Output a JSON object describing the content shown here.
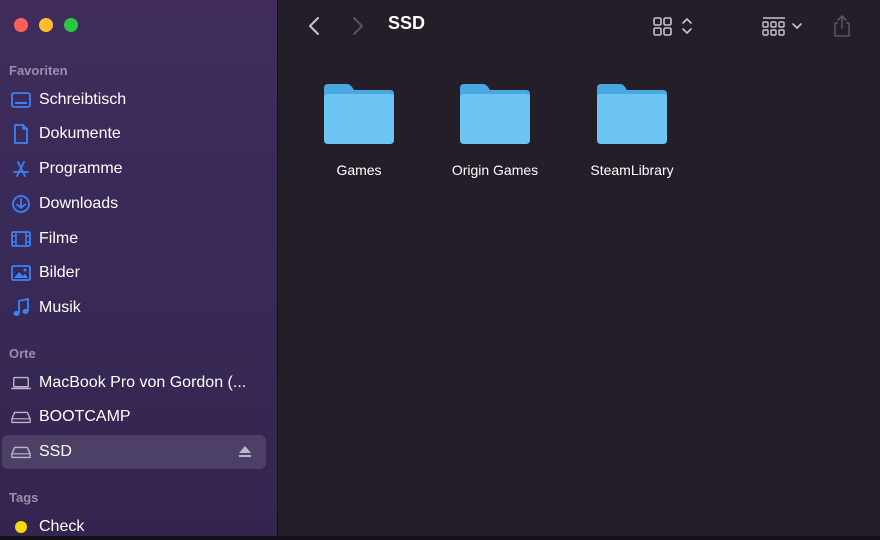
{
  "window": {
    "title": "SSD",
    "traffic_lights": {
      "close": "#ff5f57",
      "minimize": "#febc2e",
      "zoom": "#28c840"
    }
  },
  "sidebar": {
    "sections": [
      {
        "title": "Favoriten",
        "items": [
          {
            "label": "Schreibtisch",
            "icon": "desktop-icon"
          },
          {
            "label": "Dokumente",
            "icon": "document-icon"
          },
          {
            "label": "Programme",
            "icon": "applications-icon"
          },
          {
            "label": "Downloads",
            "icon": "download-icon"
          },
          {
            "label": "Filme",
            "icon": "film-icon"
          },
          {
            "label": "Bilder",
            "icon": "photo-icon"
          },
          {
            "label": "Musik",
            "icon": "music-icon"
          }
        ]
      },
      {
        "title": "Orte",
        "items": [
          {
            "label": "MacBook Pro von Gordon (...",
            "icon": "laptop-icon"
          },
          {
            "label": "BOOTCAMP",
            "icon": "drive-icon"
          },
          {
            "label": "SSD",
            "icon": "drive-icon",
            "selected": true,
            "eject": "eject-icon"
          }
        ]
      },
      {
        "title": "Tags",
        "items": [
          {
            "label": "Check",
            "icon": "tag-dot-icon",
            "color": "#f5d90a"
          }
        ]
      }
    ]
  },
  "main": {
    "folders": [
      {
        "name": "Games"
      },
      {
        "name": "Origin Games"
      },
      {
        "name": "SteamLibrary"
      }
    ]
  },
  "colors": {
    "accent": "#3b82f6",
    "folder": "#69c3f2"
  }
}
